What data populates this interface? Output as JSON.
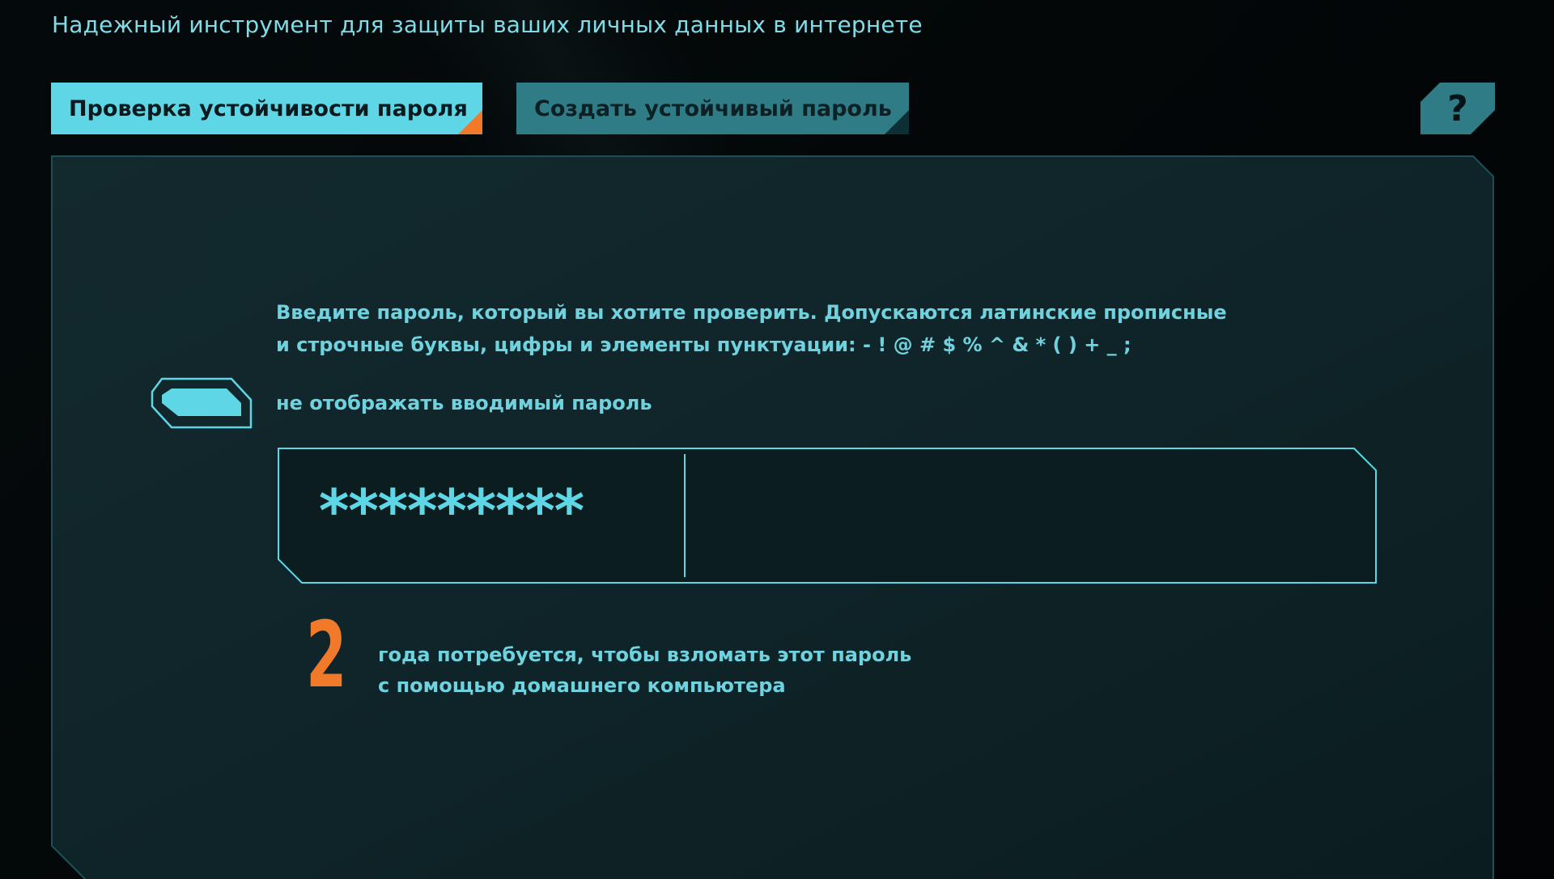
{
  "header": {
    "subtitle": "Надежный инструмент для защиты ваших личных данных в интернете"
  },
  "tabs": [
    {
      "label": "Проверка устойчивости пароля",
      "active": true
    },
    {
      "label": "Создать устойчивый пароль",
      "active": false
    }
  ],
  "help": {
    "label": "?"
  },
  "checker": {
    "instructions_line1": "Введите пароль, который вы хотите проверить. Допускаются латинские прописные",
    "instructions_line2": "и строчные буквы, цифры и элементы пунктуации: - ! @ # $ % ^ & * ( ) + _ ;",
    "hide_toggle_label": "не отображать вводимый пароль",
    "hide_toggle_on": true,
    "password_masked": "*********",
    "result_value": "2",
    "result_line1": "года потребуется, чтобы взломать этот пароль",
    "result_line2": "с помощью домашнего компьютера"
  },
  "colors": {
    "accent": "#5ed6e5",
    "accent_dark": "#2f7c86",
    "highlight": "#f07a2a",
    "panel_bg": "#0d2226",
    "text": "#6fd2df"
  }
}
